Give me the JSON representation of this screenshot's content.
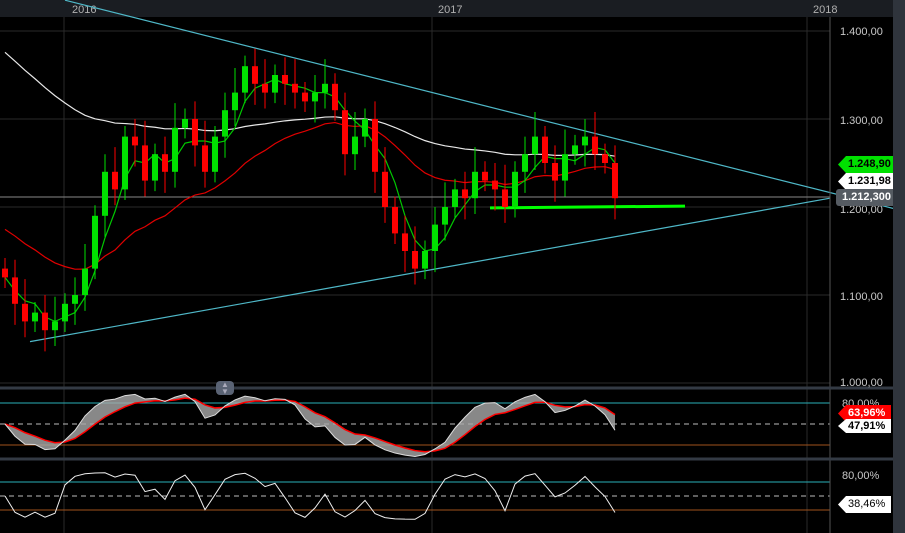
{
  "header": {
    "years": [
      "2016",
      "2017",
      "2018"
    ]
  },
  "price_axis": {
    "labels": [
      "1.400,00",
      "1.300,00",
      "1.200,00",
      "1.100,00",
      "1.000,00"
    ]
  },
  "tags": {
    "last_price": "1.248,90",
    "ma_value": "1.231,98",
    "cursor_price": "1.212,300",
    "osc1_value": "63,96%",
    "osc1_signal": "47,91%",
    "osc1_level": "80,00%",
    "osc2_level": "80,00%",
    "osc2_value": "38,46%"
  },
  "colors": {
    "up": "#00e000",
    "down": "#ff0000",
    "trend": "#4fb8c8",
    "fast_ma": "#00c800",
    "mid_ma": "#e00000",
    "slow_ma": "#e8e8e8"
  },
  "chart_data": {
    "type": "candlestick",
    "price_ticks": [
      1.4,
      1.3,
      1.2,
      1.1,
      1.0
    ],
    "ylim": [
      1.0,
      1.435
    ],
    "closes": [
      1.12,
      1.09,
      1.07,
      1.08,
      1.06,
      1.07,
      1.09,
      1.1,
      1.13,
      1.19,
      1.24,
      1.22,
      1.28,
      1.27,
      1.23,
      1.26,
      1.24,
      1.29,
      1.3,
      1.27,
      1.24,
      1.28,
      1.31,
      1.33,
      1.36,
      1.34,
      1.33,
      1.35,
      1.34,
      1.33,
      1.32,
      1.33,
      1.34,
      1.31,
      1.26,
      1.28,
      1.3,
      1.24,
      1.2,
      1.17,
      1.15,
      1.13,
      1.15,
      1.18,
      1.2,
      1.22,
      1.21,
      1.24,
      1.23,
      1.22,
      1.2,
      1.24,
      1.26,
      1.28,
      1.25,
      1.23,
      1.26,
      1.27,
      1.28,
      1.26,
      1.25,
      1.21
    ],
    "trendlines": [
      {
        "name": "upper",
        "from": [
          6,
          1.435
        ],
        "to": [
          90,
          1.195
        ]
      },
      {
        "name": "lower",
        "from": [
          2.5,
          1.047
        ],
        "to": [
          82.5,
          1.21
        ]
      },
      {
        "name": "support",
        "from": [
          48.5,
          1.199
        ],
        "to": [
          68,
          1.201
        ]
      }
    ],
    "oscillator_levels": [
      80,
      50,
      20
    ]
  }
}
